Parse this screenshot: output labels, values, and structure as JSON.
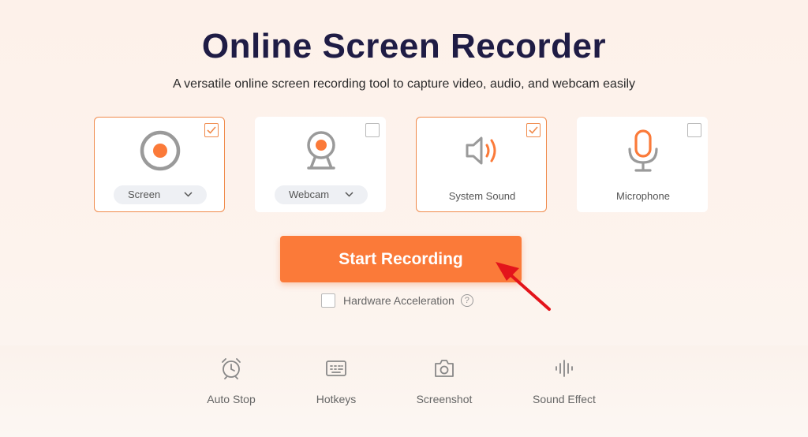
{
  "header": {
    "title": "Online Screen Recorder",
    "subtitle": "A versatile online screen recording tool to capture video, audio, and webcam easily"
  },
  "sources": [
    {
      "id": "screen",
      "icon": "screen-record-icon",
      "checked": true,
      "dropdown": "Screen"
    },
    {
      "id": "webcam",
      "icon": "webcam-icon",
      "checked": false,
      "dropdown": "Webcam"
    },
    {
      "id": "system-sound",
      "icon": "speaker-icon",
      "checked": true,
      "label": "System Sound"
    },
    {
      "id": "microphone",
      "icon": "microphone-icon",
      "checked": false,
      "label": "Microphone"
    }
  ],
  "start_button": {
    "label": "Start Recording"
  },
  "hardware_acceleration": {
    "label": "Hardware Acceleration",
    "checked": false,
    "help": "?"
  },
  "features": [
    {
      "icon": "alarm-clock-icon",
      "label": "Auto Stop"
    },
    {
      "icon": "keyboard-icon",
      "label": "Hotkeys"
    },
    {
      "icon": "camera-icon",
      "label": "Screenshot"
    },
    {
      "icon": "sound-wave-icon",
      "label": "Sound Effect"
    }
  ],
  "colors": {
    "accent": "#fb7a39",
    "title": "#1f1c45",
    "selected_border": "#f08a4b"
  }
}
